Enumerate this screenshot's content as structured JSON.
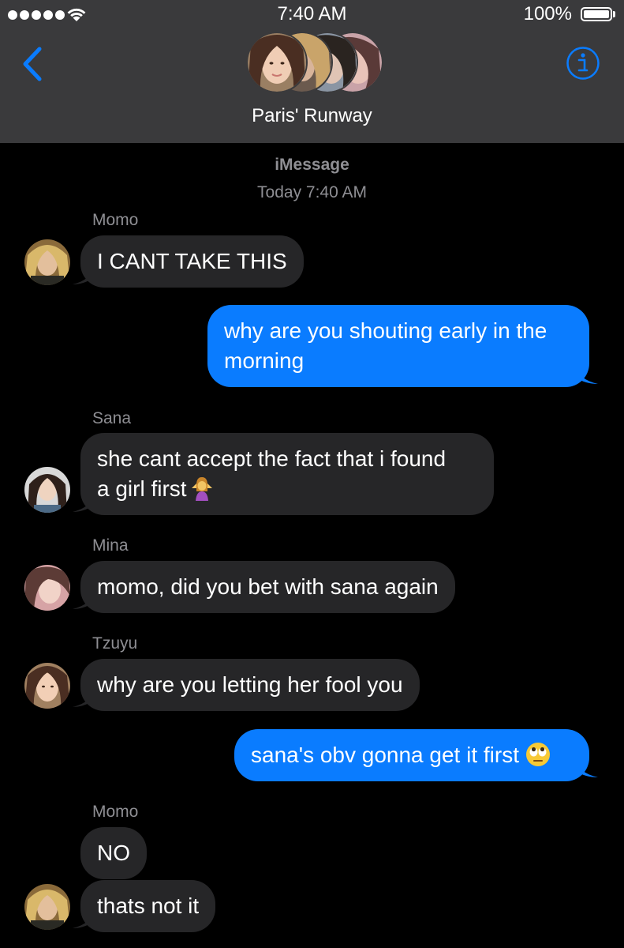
{
  "status_bar": {
    "time": "7:40 AM",
    "battery": "100%"
  },
  "header": {
    "group_name": "Paris' Runway",
    "back_icon": "chevron-left-icon",
    "info_icon": "info-icon"
  },
  "conversation": {
    "service": "iMessage",
    "timestamp": "Today 7:40 AM",
    "messages": [
      {
        "sender": "Momo",
        "lines": [
          "I CANT TAKE THIS"
        ]
      },
      {
        "sender": "me",
        "lines": [
          "why are you shouting early in the",
          "morning"
        ]
      },
      {
        "sender": "Sana",
        "lines": [
          "she cant accept the fact that i found",
          "a girl first"
        ],
        "emoji": "person-shrugging"
      },
      {
        "sender": "Mina",
        "lines": [
          "momo, did you bet with sana again"
        ]
      },
      {
        "sender": "Tzuyu",
        "lines": [
          "why are you letting her fool you"
        ]
      },
      {
        "sender": "me",
        "lines": [
          "sana's obv gonna get it first"
        ],
        "emoji": "face-with-rolling-eyes"
      },
      {
        "sender": "Momo",
        "lines": [
          "NO"
        ]
      },
      {
        "sender": "Momo",
        "lines": [
          "thats not it"
        ]
      }
    ]
  },
  "colors": {
    "header_bg": "#3a3a3c",
    "incoming_bubble": "#262628",
    "outgoing_bubble": "#0a7cff",
    "accent": "#0a7cff"
  }
}
